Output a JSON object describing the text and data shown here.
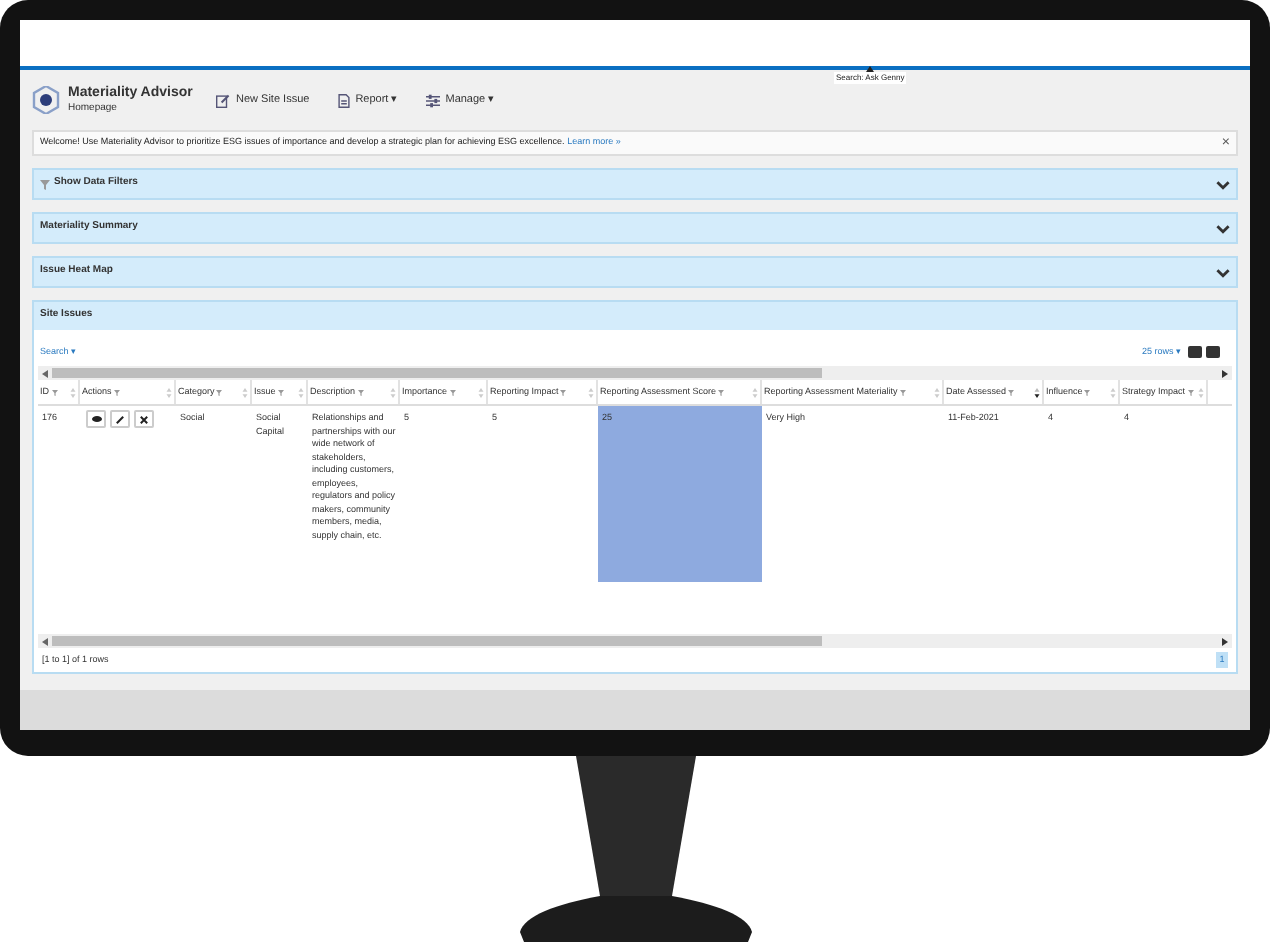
{
  "app": {
    "title": "Materiality Advisor",
    "subtitle": "Homepage"
  },
  "nav": [
    {
      "label": "New Site Issue",
      "kind": "edit"
    },
    {
      "label": "Report ▾",
      "kind": "report"
    },
    {
      "label": "Manage ▾",
      "kind": "manage"
    }
  ],
  "search_tooltip": "Search: Ask Genny",
  "welcome": {
    "text": "Welcome! Use Materiality Advisor to prioritize ESG issues of importance and develop a strategic plan for achieving ESG excellence.",
    "link": "Learn more »",
    "close": "×"
  },
  "panels": [
    {
      "title": "Show Data Filters",
      "kind": "filter",
      "expanded": false
    },
    {
      "title": "Materiality Summary",
      "kind": "section",
      "expanded": false
    },
    {
      "title": "Issue Heat Map",
      "kind": "section",
      "expanded": false
    },
    {
      "title": "Site Issues",
      "kind": "section",
      "expanded": true
    }
  ],
  "table": {
    "search": "Search ▾",
    "rows_per_page": "25 rows ▾",
    "columns": [
      {
        "label": "ID",
        "sorted": false
      },
      {
        "label": "Actions",
        "sorted": false
      },
      {
        "label": "Category",
        "sorted": false
      },
      {
        "label": "Issue",
        "sorted": false
      },
      {
        "label": "Description",
        "sorted": false
      },
      {
        "label": "Importance",
        "sorted": false
      },
      {
        "label": "Reporting Impact",
        "sorted": false
      },
      {
        "label": "Reporting Assessment Score",
        "sorted": false
      },
      {
        "label": "Reporting Assessment Materiality",
        "sorted": false
      },
      {
        "label": "Date Assessed",
        "sorted": true
      },
      {
        "label": "Influence",
        "sorted": false
      },
      {
        "label": "Strategy Impact",
        "sorted": false
      }
    ],
    "rows": [
      {
        "cells": [
          "176",
          "",
          "Social",
          "Social Capital",
          "Relationships and partnerships with our wide network of stakeholders, including customers, employees, regulators and policy makers, community members, media, supply chain, etc.",
          "5",
          "5",
          "25",
          "Very High",
          "11-Feb-2021",
          "4",
          "4"
        ],
        "score_highlighted": true
      }
    ],
    "footer": "[1 to 1] of 1 rows",
    "pages": [
      {
        "label": "1",
        "selected": true
      }
    ]
  }
}
